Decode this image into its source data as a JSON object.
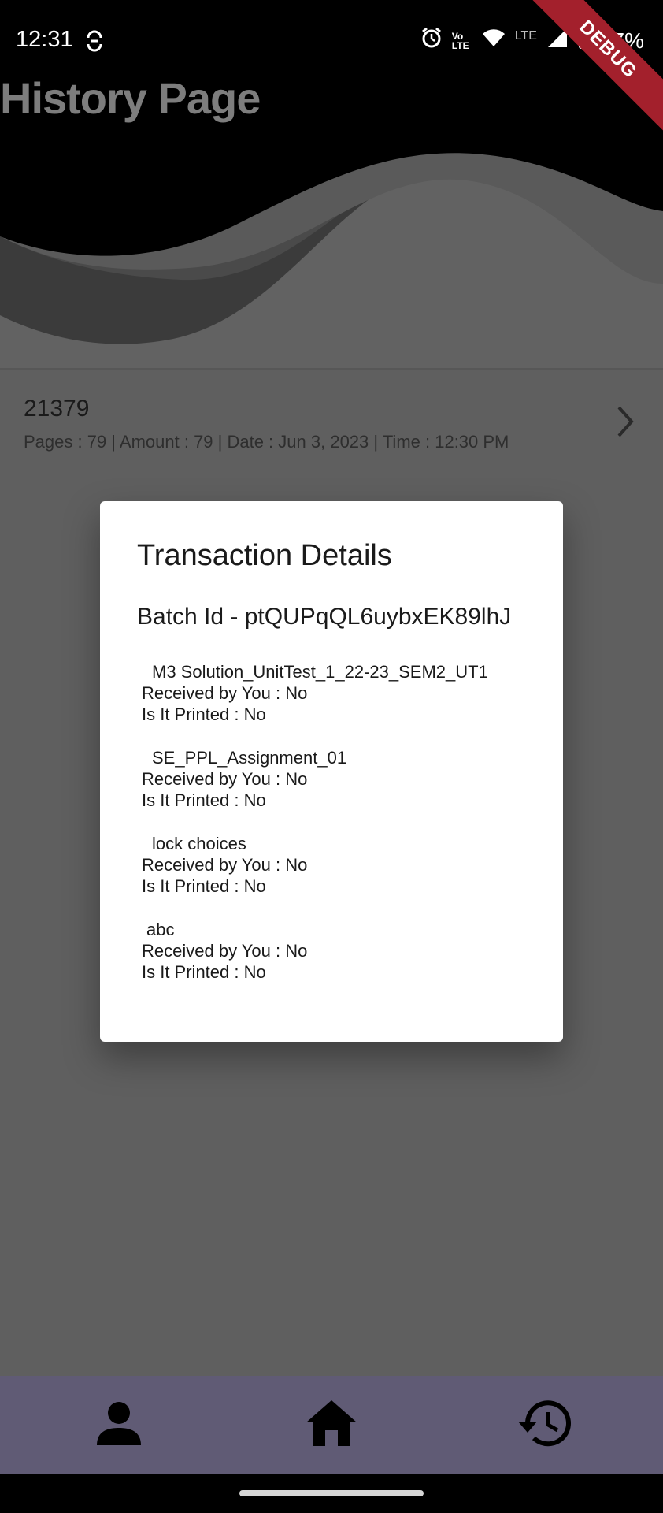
{
  "status_bar": {
    "time": "12:31",
    "battery": "57%",
    "network_label": "LTE",
    "volte_label": "Vo LTE",
    "debug_label": "DEBUG",
    "icons": [
      "sync-icon",
      "alarm-icon",
      "volte-icon",
      "wifi-icon",
      "signal-icon",
      "battery-icon"
    ]
  },
  "header": {
    "title": "History Page"
  },
  "history": {
    "items": [
      {
        "id": "21379",
        "details": "Pages : 79 | Amount : 79 | Date : Jun 3, 2023 | Time : 12:30 PM"
      }
    ]
  },
  "dialog": {
    "title": "Transaction Details",
    "batch": "Batch Id - ptQUPqQL6uybxEK89lhJ",
    "files": [
      {
        "name": "M3 Solution_UnitTest_1_22-23_SEM2_UT1",
        "received": "Received by You : No",
        "printed": "Is It Printed : No"
      },
      {
        "name": "SE_PPL_Assignment_01",
        "received": "Received by You : No",
        "printed": "Is It Printed : No"
      },
      {
        "name": "lock choices",
        "received": "Received by You : No",
        "printed": "Is It Printed : No"
      },
      {
        "name": "abc",
        "received": "Received by You : No",
        "printed": "Is It Printed : No"
      }
    ]
  },
  "bottom_nav": {
    "items": [
      {
        "icon": "person-icon"
      },
      {
        "icon": "home-icon"
      },
      {
        "icon": "history-icon"
      }
    ],
    "background": "#605b75"
  },
  "colors": {
    "scrim": "#5f5f5f",
    "wave_dark": "#000000",
    "wave_mid": "#3a3a3a",
    "dialog_bg": "#ffffff",
    "debug_ribbon": "#a3202c"
  }
}
